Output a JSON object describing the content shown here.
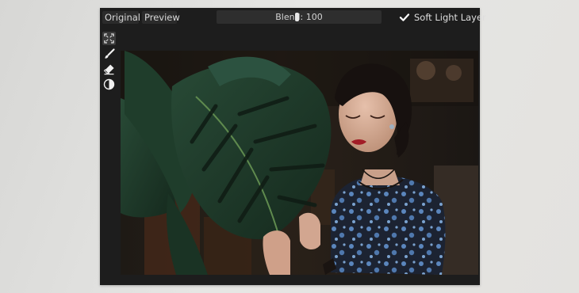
{
  "toolbar": {
    "original_label": "Original",
    "preview_label": "Preview",
    "blend": {
      "label": "Blend: 100",
      "value": 100,
      "max": 100
    },
    "soft_light_layer": {
      "label": "Soft Light Layer",
      "checked": true
    }
  },
  "tools": [
    {
      "icon": "fit-screen-icon"
    },
    {
      "icon": "brush-icon"
    },
    {
      "icon": "eraser-icon"
    },
    {
      "icon": "contrast-icon"
    }
  ],
  "canvas": {
    "subject": "photo"
  },
  "colors": {
    "window_bg": "#1d1d1d",
    "button_bg": "#2b2b2b",
    "text": "#d8d8d8",
    "check": "#ffffff"
  }
}
